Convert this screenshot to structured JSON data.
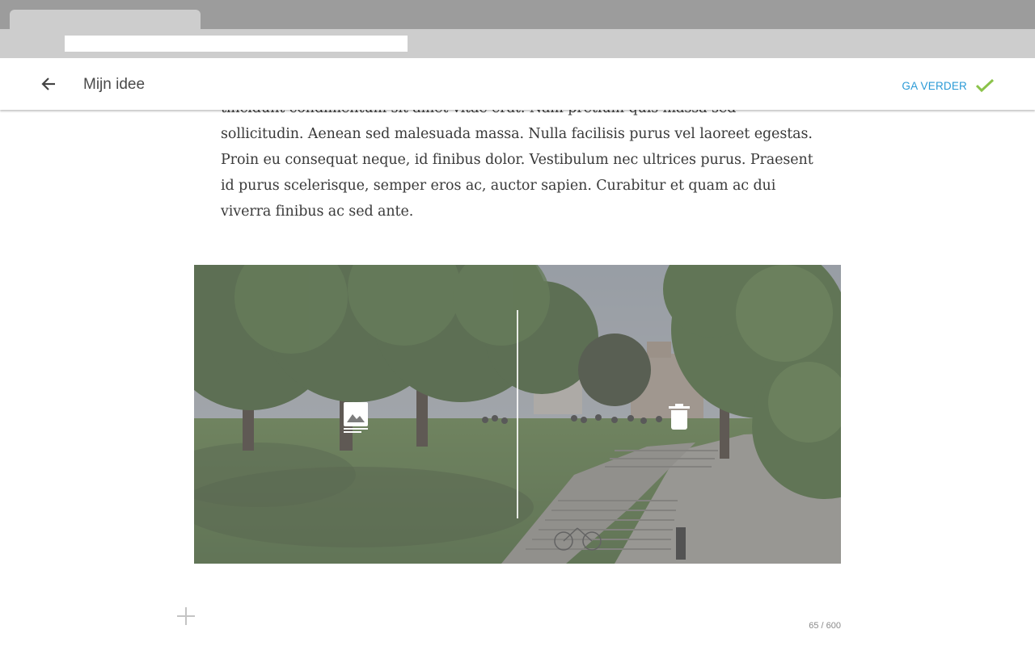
{
  "browser": {
    "tab_title": "",
    "url": ""
  },
  "header": {
    "title": "Mijn idee",
    "continue_label": "GA VERDER",
    "back_icon": "arrow-left-icon",
    "check_icon": "check-icon"
  },
  "editor": {
    "paragraph": "tincidunt condimentum sit amet vitae erat. Nam pretium quis massa sed sollicitudin. Aenean sed malesuada massa. Nulla facilisis purus vel laoreet egestas. Proin eu consequat neque, id finibus dolor. Vestibulum nec ultrices purus. Praesent id purus scelerisque, semper eros ac, auctor sapien. Curabitur et quam ac dui viverra finibus ac sed ante.",
    "image_actions": {
      "edit_icon": "image-caption-icon",
      "delete_icon": "trash-icon"
    },
    "add_icon": "plus-icon",
    "char_count": "65 / 600"
  },
  "colors": {
    "accent": "#2a9ad6",
    "check": "#8bc34a",
    "title": "#4a4a4a"
  }
}
